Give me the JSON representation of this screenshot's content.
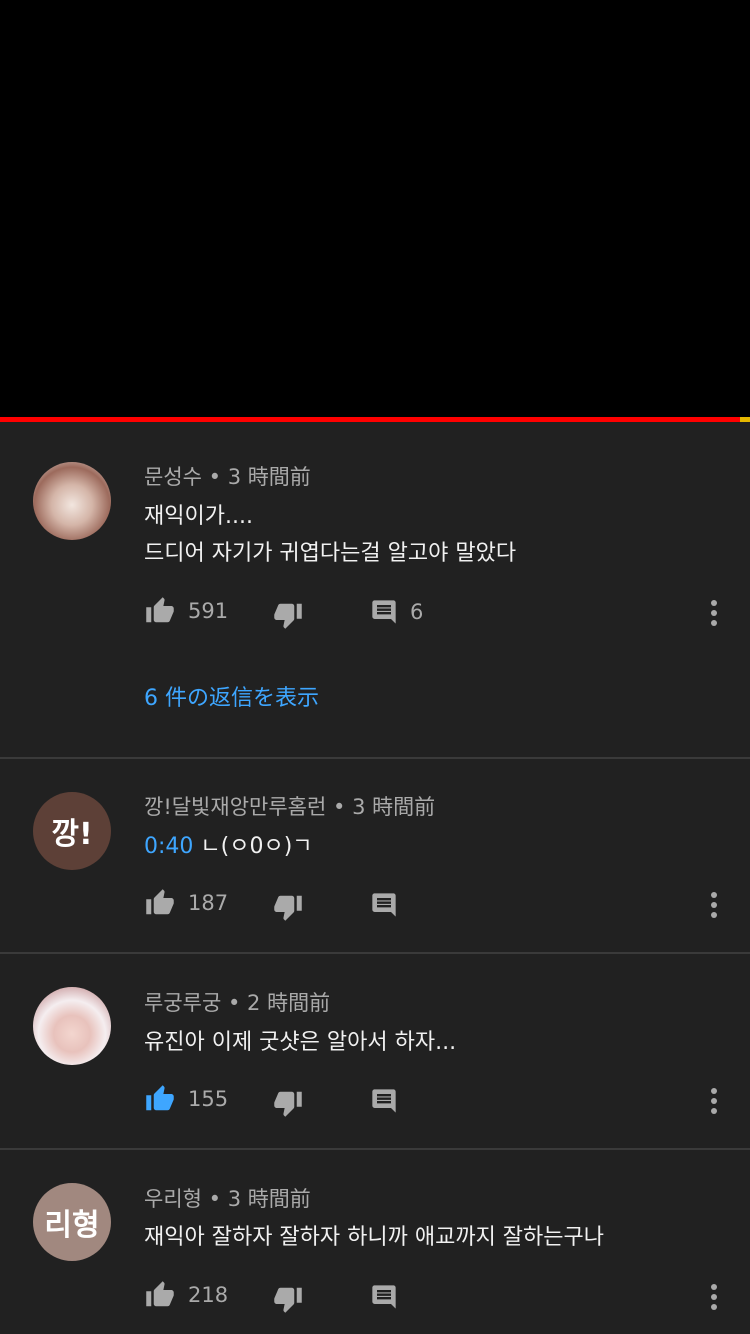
{
  "player": {
    "progress_percent": 98.7
  },
  "comments": [
    {
      "author": "문성수",
      "time": "3 時間前",
      "lines": [
        "재익이가....",
        "드디어 자기가 귀엽다는걸 알고야 말았다"
      ],
      "likes": "591",
      "replies_count": "6",
      "liked": false,
      "avatar_color": "#b99a8a"
    },
    {
      "author": "깡!달빛재앙만루홈런",
      "time": "3 時間前",
      "timestamp_link": "0:40",
      "lines": [
        "ㄴ(ㅇ0ㅇ)ㄱ"
      ],
      "likes": "187",
      "liked": false,
      "avatar_text": "깡!",
      "avatar_color": "#5d4037"
    },
    {
      "author": "루궁루궁",
      "time": "2 時間前",
      "lines": [
        "유진아 이제 굿샷은 알아서 하자..."
      ],
      "likes": "155",
      "liked": true,
      "avatar_color": "#e8c7c8"
    },
    {
      "author": "우리형",
      "time": "3 時間前",
      "lines": [
        "재익아 잘하자 잘하자 하니까 애교까지 잘하는구나"
      ],
      "likes": "218",
      "liked": false,
      "avatar_text": "리형",
      "avatar_color": "#a1887f"
    }
  ],
  "show_replies_label": "6 件の返信を表示",
  "separator": "•",
  "colors": {
    "accent": "#3ea6ff",
    "progress": "#ff0000",
    "muted": "#aaaaaa"
  },
  "icons": [
    "thumb-up-icon",
    "thumb-down-icon",
    "reply-icon",
    "more-vert-icon"
  ]
}
